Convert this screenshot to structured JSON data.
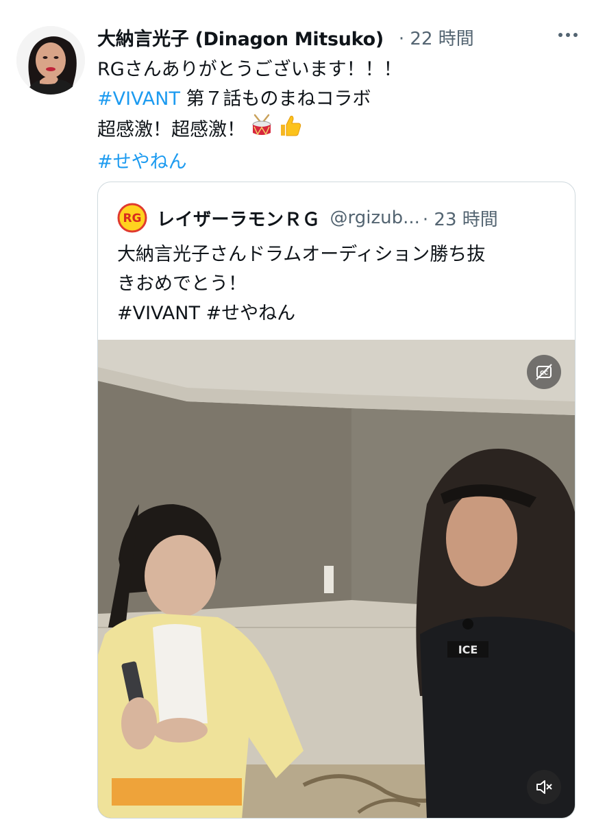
{
  "tweet": {
    "display_name": "大納言光子 (Dinagon Mitsuko)",
    "time": "· 22 時間",
    "lines": {
      "l1": "RGさんありがとうございます！！！",
      "l2_tag": "#VIVANT",
      "l2_rest": " 第７話ものまねコラボ",
      "l3": "超感激！超感激！",
      "l4_tag": "#せやねん"
    },
    "emoji": [
      "drum-icon",
      "thumbs-up-icon"
    ]
  },
  "quoted": {
    "name": "レイザーラモンＲＧ",
    "handle": "@rgizub...",
    "time": "· 23 時間",
    "avatar_text": "RG",
    "lines": {
      "l1": "大納言光子さんドラムオーディション勝ち抜",
      "l2": "きおめでとう！",
      "l3": "#VIVANT #せやねん"
    },
    "media": {
      "caption_button_icon": "captions-off-icon",
      "mute_button_icon": "volume-muted-icon",
      "uniform_text": "ICE"
    }
  },
  "colors": {
    "text": "#0f1419",
    "secondary": "#536471",
    "link": "#1d9bf0",
    "border": "#cfd9de"
  }
}
